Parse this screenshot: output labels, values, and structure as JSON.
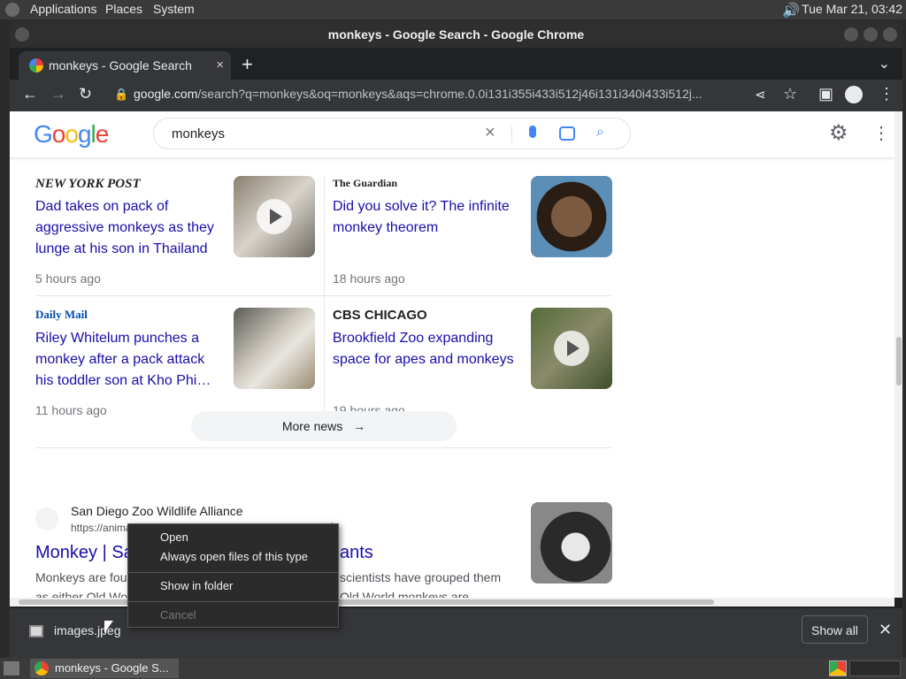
{
  "panel": {
    "applications": "Applications",
    "places": "Places",
    "system": "System",
    "clock": "Tue Mar 21, 03:42"
  },
  "window": {
    "title": "monkeys - Google Search - Google Chrome"
  },
  "tabs": [
    {
      "label": "monkeys - Google Search",
      "close": "×"
    }
  ],
  "toolbar": {
    "url_host": "google.com",
    "url_rest": "/search?q=monkeys&oq=monkeys&aqs=chrome.0.0i131i355i433i512j46i131i340i433i512j..."
  },
  "google": {
    "logo": "Google",
    "query": "monkeys"
  },
  "news": [
    {
      "publisher": "NEW YORK POST",
      "title": "Dad takes on pack of aggressive monkeys as they lunge at his son in Thailand",
      "time": "5 hours ago"
    },
    {
      "publisher": "The Guardian",
      "title": "Did you solve it? The infinite monkey theorem",
      "time": "18 hours ago"
    },
    {
      "publisher": "Daily Mail",
      "title": "Riley Whitelum punches a monkey after a pack attack his toddler son at Kho Phi…",
      "time": "11 hours ago"
    },
    {
      "publisher": "CBS CHICAGO",
      "title": "Brookfield Zoo expanding space for apes and monkeys",
      "time": "19 hours ago"
    }
  ],
  "more_news": "More news",
  "result": {
    "site": "San Diego Zoo Wildlife Alliance",
    "breadcrumb": "https://animals.sandiegozoo.org › animals › monkey",
    "title_left": "Monkey | Sa",
    "title_right": "ants",
    "snippet_line1_left": "Monkeys are fou",
    "snippet_line1_right": "scientists have grouped them",
    "snippet_line2_left": "as either Old Wo",
    "snippet_line2_right": "Old World monkeys are ..."
  },
  "context_menu": {
    "open": "Open",
    "always_open": "Always open files of this type",
    "show_in_folder": "Show in folder",
    "cancel": "Cancel"
  },
  "download": {
    "filename": "images.jpeg",
    "show_all": "Show all"
  },
  "taskbar": {
    "item": "monkeys - Google S..."
  }
}
